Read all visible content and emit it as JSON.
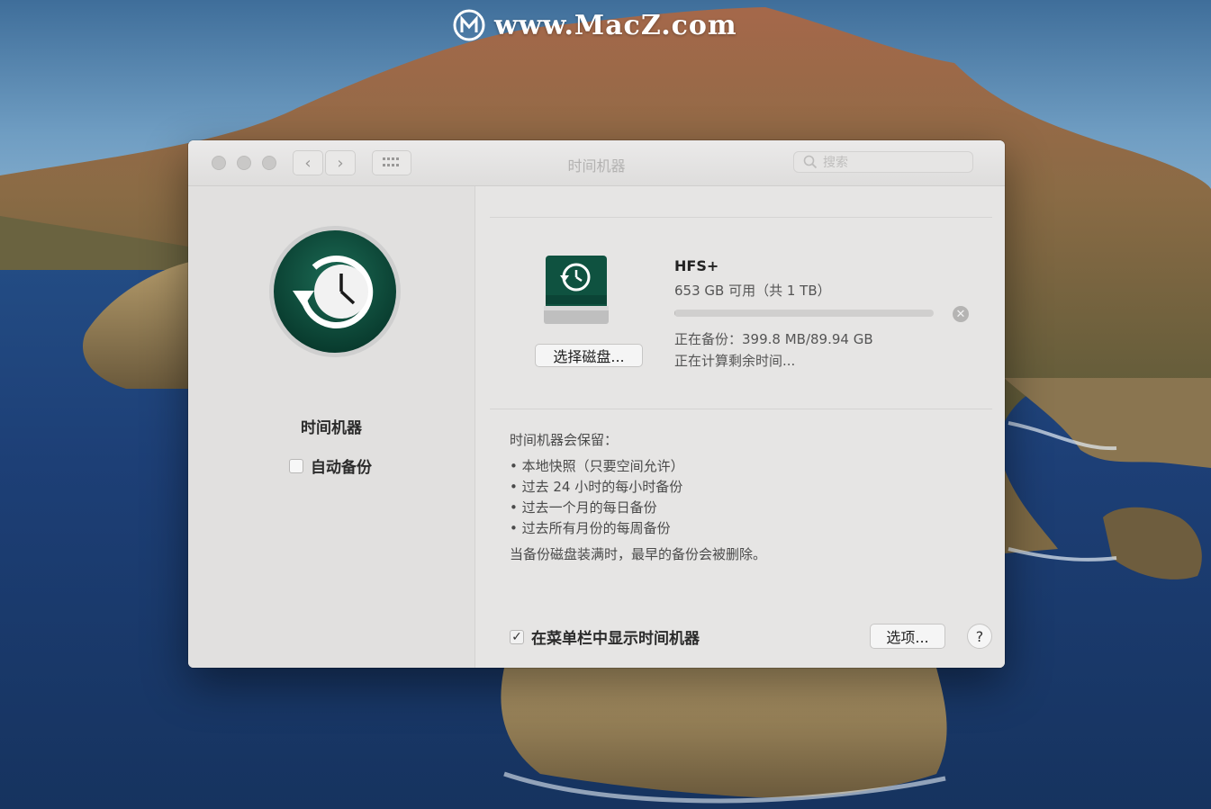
{
  "watermark": {
    "text": "www.MacZ.com"
  },
  "window": {
    "title": "时间机器",
    "search_placeholder": "搜索",
    "nav_back": "‹",
    "nav_forward": "›"
  },
  "sidebar": {
    "app_name": "时间机器",
    "auto_backup_label": "自动备份",
    "auto_backup_checked": false
  },
  "disk": {
    "name": "HFS+",
    "free": "653 GB 可用（共 1 TB）",
    "select_button": "选择磁盘...",
    "progress_fraction": 0.004,
    "status": "正在备份：399.8 MB/89.94 GB",
    "remaining": "正在计算剩余时间..."
  },
  "info": {
    "heading": "时间机器会保留：",
    "items": [
      "本地快照（只要空间允许）",
      "过去 24 小时的每小时备份",
      "过去一个月的每日备份",
      "过去所有月份的每周备份"
    ],
    "note": "当备份磁盘装满时，最早的备份会被删除。"
  },
  "footer": {
    "show_in_menubar_label": "在菜单栏中显示时间机器",
    "show_in_menubar_checked": true,
    "checkmark": "✓",
    "options_button": "选项...",
    "help_button": "?"
  },
  "colors": {
    "tm_green": "#0d4a3a",
    "window_bg": "#e4e3e2"
  }
}
